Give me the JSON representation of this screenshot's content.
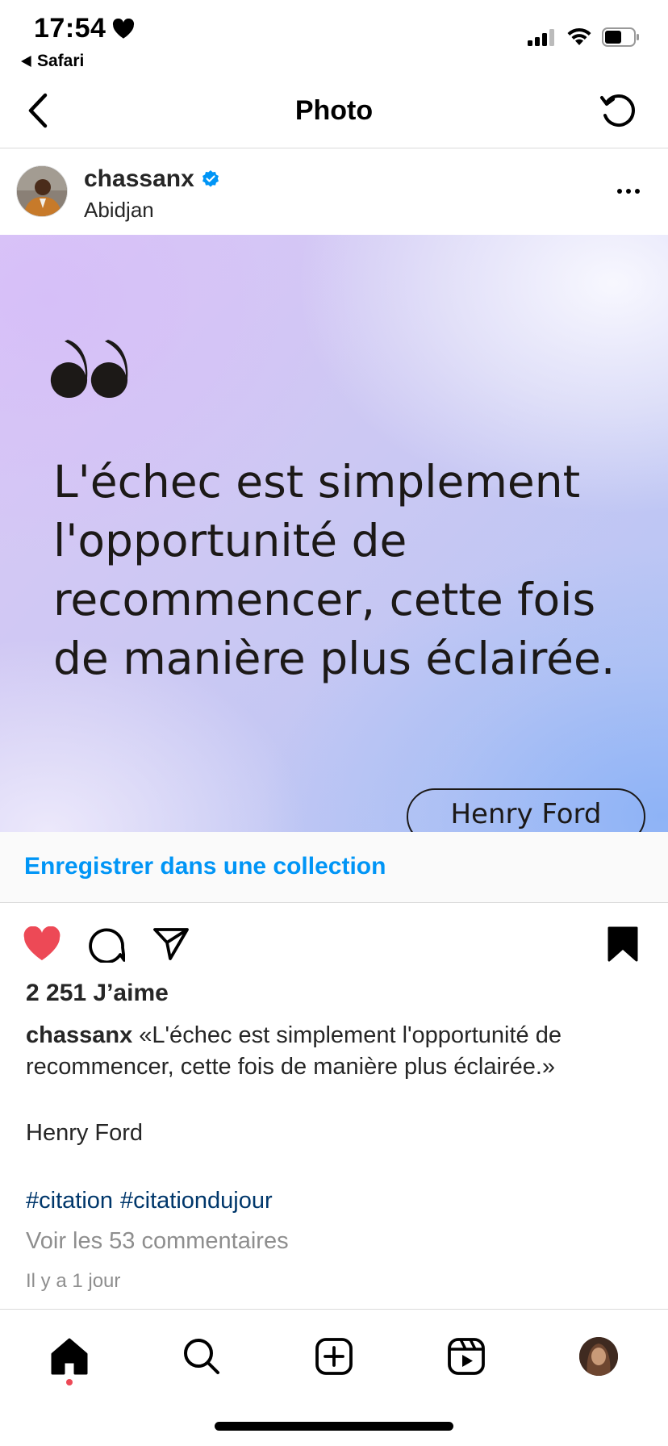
{
  "status_bar": {
    "time": "17:54",
    "back_app": "Safari"
  },
  "nav": {
    "title": "Photo"
  },
  "post": {
    "username": "chassanx",
    "location": "Abidjan",
    "verified": true,
    "quote": "L'échec est simplement l'opportunité de recommencer, cette fois de manière plus éclairée.",
    "quote_author": "Henry Ford"
  },
  "collection": {
    "label": "Enregistrer dans une collection"
  },
  "engagement": {
    "likes": "2 251 J’aime",
    "liked": true,
    "saved": true
  },
  "caption": {
    "user": "chassanx",
    "text": "«L'échec est simplement l'opportunité de recommencer, cette fois de manière plus éclairée.»",
    "author": "Henry Ford",
    "hashtags": [
      "#citation",
      "#citationdujour"
    ],
    "comments_link": "Voir les 53 commentaires",
    "timestamp": "Il y a 1 jour"
  },
  "colors": {
    "accent_blue": "#0095f6",
    "like_red": "#ed4956",
    "hashtag": "#00376b",
    "muted": "#8e8e8e"
  },
  "icons": {
    "status": [
      "heart-icon",
      "signal-icon",
      "wifi-icon",
      "battery-icon"
    ],
    "nav": [
      "chevron-left-icon",
      "refresh-icon"
    ],
    "actions": [
      "heart-icon",
      "comment-icon",
      "share-icon",
      "bookmark-icon"
    ],
    "tabs": [
      "home-icon",
      "search-icon",
      "add-post-icon",
      "reels-icon",
      "profile-avatar"
    ]
  }
}
